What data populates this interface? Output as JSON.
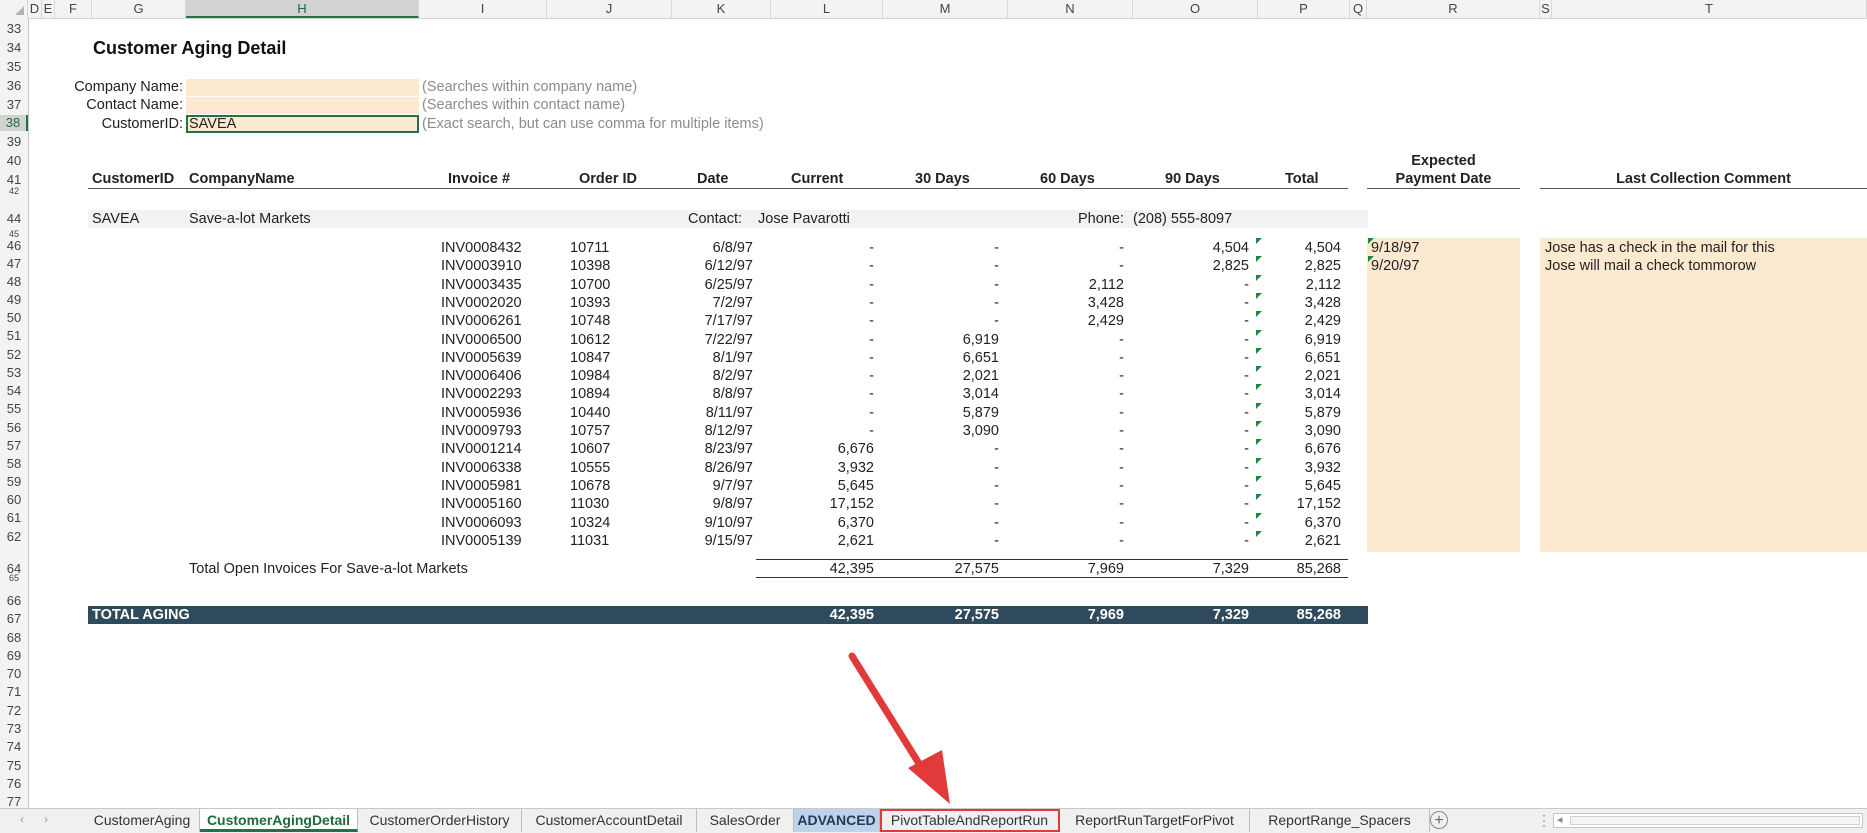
{
  "columns": [
    "D",
    "E",
    "F",
    "G",
    "H",
    "I",
    "J",
    "K",
    "L",
    "M",
    "N",
    "O",
    "P",
    "Q",
    "R",
    "S",
    "T"
  ],
  "selected_column": "H",
  "row_numbers": [
    "33",
    "34",
    "35",
    "36",
    "37",
    "38",
    "39",
    "40",
    "41",
    "42",
    "44",
    "45",
    "46",
    "47",
    "48",
    "49",
    "50",
    "51",
    "52",
    "53",
    "54",
    "55",
    "56",
    "57",
    "58",
    "59",
    "60",
    "61",
    "62",
    "64",
    "65",
    "66",
    "67",
    "68",
    "69",
    "70",
    "71",
    "72",
    "73",
    "74",
    "75",
    "76",
    "77"
  ],
  "selected_row": "38",
  "report": {
    "title": "Customer Aging Detail",
    "filters": [
      {
        "label": "Company Name:",
        "value": "",
        "hint": "(Searches within company name)"
      },
      {
        "label": "Contact Name:",
        "value": "",
        "hint": "(Searches within contact name)"
      },
      {
        "label": "CustomerID:",
        "value": "SAVEA",
        "hint": "(Exact search, but can use comma for multiple items)"
      }
    ],
    "headers": {
      "customer_id": "CustomerID",
      "company_name": "CompanyName",
      "invoice": "Invoice #",
      "order_id": "Order ID",
      "date": "Date",
      "current": "Current",
      "d30": "30 Days",
      "d60": "60 Days",
      "d90": "90 Days",
      "total": "Total",
      "expected_line1": "Expected",
      "expected_line2": "Payment Date",
      "comment": "Last Collection Comment"
    },
    "customer": {
      "id": "SAVEA",
      "name": "Save-a-lot Markets",
      "contact_label": "Contact:",
      "contact": "Jose Pavarotti",
      "phone_label": "Phone:",
      "phone": "(208) 555-8097"
    },
    "invoices": [
      {
        "inv": "INV0008432",
        "order": "10711",
        "date": "6/8/97",
        "cur": "-",
        "d30": "-",
        "d60": "-",
        "d90": "4,504",
        "total": "4,504",
        "expected": "9/18/97",
        "comment": "Jose has a check in the mail for this"
      },
      {
        "inv": "INV0003910",
        "order": "10398",
        "date": "6/12/97",
        "cur": "-",
        "d30": "-",
        "d60": "-",
        "d90": "2,825",
        "total": "2,825",
        "expected": "9/20/97",
        "comment": "Jose will mail a check tommorow"
      },
      {
        "inv": "INV0003435",
        "order": "10700",
        "date": "6/25/97",
        "cur": "-",
        "d30": "-",
        "d60": "2,112",
        "d90": "-",
        "total": "2,112",
        "expected": "",
        "comment": ""
      },
      {
        "inv": "INV0002020",
        "order": "10393",
        "date": "7/2/97",
        "cur": "-",
        "d30": "-",
        "d60": "3,428",
        "d90": "-",
        "total": "3,428",
        "expected": "",
        "comment": ""
      },
      {
        "inv": "INV0006261",
        "order": "10748",
        "date": "7/17/97",
        "cur": "-",
        "d30": "-",
        "d60": "2,429",
        "d90": "-",
        "total": "2,429",
        "expected": "",
        "comment": ""
      },
      {
        "inv": "INV0006500",
        "order": "10612",
        "date": "7/22/97",
        "cur": "-",
        "d30": "6,919",
        "d60": "-",
        "d90": "-",
        "total": "6,919",
        "expected": "",
        "comment": ""
      },
      {
        "inv": "INV0005639",
        "order": "10847",
        "date": "8/1/97",
        "cur": "-",
        "d30": "6,651",
        "d60": "-",
        "d90": "-",
        "total": "6,651",
        "expected": "",
        "comment": ""
      },
      {
        "inv": "INV0006406",
        "order": "10984",
        "date": "8/2/97",
        "cur": "-",
        "d30": "2,021",
        "d60": "-",
        "d90": "-",
        "total": "2,021",
        "expected": "",
        "comment": ""
      },
      {
        "inv": "INV0002293",
        "order": "10894",
        "date": "8/8/97",
        "cur": "-",
        "d30": "3,014",
        "d60": "-",
        "d90": "-",
        "total": "3,014",
        "expected": "",
        "comment": ""
      },
      {
        "inv": "INV0005936",
        "order": "10440",
        "date": "8/11/97",
        "cur": "-",
        "d30": "5,879",
        "d60": "-",
        "d90": "-",
        "total": "5,879",
        "expected": "",
        "comment": ""
      },
      {
        "inv": "INV0009793",
        "order": "10757",
        "date": "8/12/97",
        "cur": "-",
        "d30": "3,090",
        "d60": "-",
        "d90": "-",
        "total": "3,090",
        "expected": "",
        "comment": ""
      },
      {
        "inv": "INV0001214",
        "order": "10607",
        "date": "8/23/97",
        "cur": "6,676",
        "d30": "-",
        "d60": "-",
        "d90": "-",
        "total": "6,676",
        "expected": "",
        "comment": ""
      },
      {
        "inv": "INV0006338",
        "order": "10555",
        "date": "8/26/97",
        "cur": "3,932",
        "d30": "-",
        "d60": "-",
        "d90": "-",
        "total": "3,932",
        "expected": "",
        "comment": ""
      },
      {
        "inv": "INV0005981",
        "order": "10678",
        "date": "9/7/97",
        "cur": "5,645",
        "d30": "-",
        "d60": "-",
        "d90": "-",
        "total": "5,645",
        "expected": "",
        "comment": ""
      },
      {
        "inv": "INV0005160",
        "order": "11030",
        "date": "9/8/97",
        "cur": "17,152",
        "d30": "-",
        "d60": "-",
        "d90": "-",
        "total": "17,152",
        "expected": "",
        "comment": ""
      },
      {
        "inv": "INV0006093",
        "order": "10324",
        "date": "9/10/97",
        "cur": "6,370",
        "d30": "-",
        "d60": "-",
        "d90": "-",
        "total": "6,370",
        "expected": "",
        "comment": ""
      },
      {
        "inv": "INV0005139",
        "order": "11031",
        "date": "9/15/97",
        "cur": "2,621",
        "d30": "-",
        "d60": "-",
        "d90": "-",
        "total": "2,621",
        "expected": "",
        "comment": ""
      }
    ],
    "subtotal": {
      "label": "Total Open Invoices For Save-a-lot Markets",
      "cur": "42,395",
      "d30": "27,575",
      "d60": "7,969",
      "d90": "7,329",
      "total": "85,268"
    },
    "grand_total": {
      "label": "TOTAL AGING",
      "cur": "42,395",
      "d30": "27,575",
      "d60": "7,969",
      "d90": "7,329",
      "total": "85,268"
    }
  },
  "tabs": [
    {
      "label": "CustomerAging",
      "style": "normal"
    },
    {
      "label": "CustomerAgingDetail",
      "style": "active"
    },
    {
      "label": "CustomerOrderHistory",
      "style": "normal"
    },
    {
      "label": "CustomerAccountDetail",
      "style": "normal"
    },
    {
      "label": "SalesOrder",
      "style": "normal"
    },
    {
      "label": "ADVANCED",
      "style": "blue"
    },
    {
      "label": "PivotTableAndReportRun",
      "style": "boxed"
    },
    {
      "label": "ReportRunTargetForPivot",
      "style": "normal"
    },
    {
      "label": "ReportRange_Spacers",
      "style": "normal"
    }
  ],
  "colors": {
    "accent": "#217346",
    "input_fill": "#fde9d0",
    "total_bar": "#2f4a5c",
    "arrow": "#e23a3a",
    "header_active": "#1e6b3a"
  },
  "icons": [
    "add-sheet-icon",
    "scroll-left-icon",
    "scroll-right-icon",
    "annotation-arrow-icon"
  ]
}
